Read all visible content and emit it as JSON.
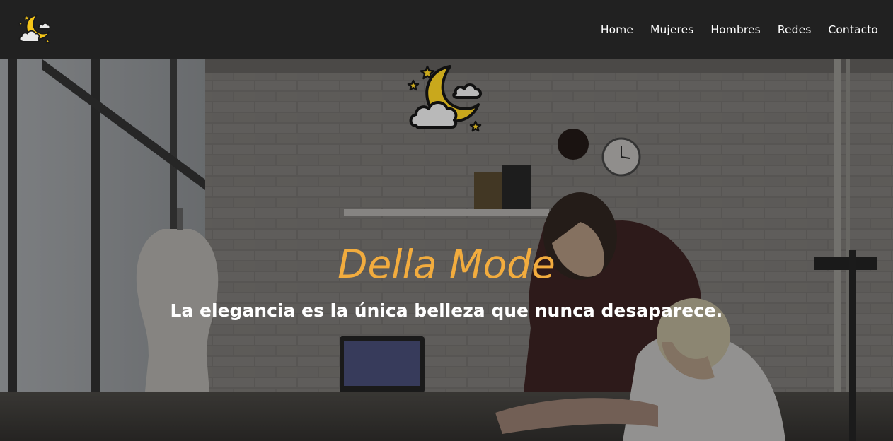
{
  "brand": {
    "logo_icon": "moon-cloud-stars-icon"
  },
  "nav": {
    "items": [
      {
        "label": "Home"
      },
      {
        "label": "Mujeres"
      },
      {
        "label": "Hombres"
      },
      {
        "label": "Redes"
      },
      {
        "label": "Contacto"
      }
    ]
  },
  "hero": {
    "logo_icon": "moon-cloud-stars-icon",
    "title": "Della Mode",
    "subtitle": "La elegancia es la única belleza que nunca desaparece.",
    "background_image": "fashion-studio-photo",
    "colors": {
      "title": "#f2ac3e",
      "subtitle": "#ffffff",
      "navbar": "#212121"
    }
  }
}
